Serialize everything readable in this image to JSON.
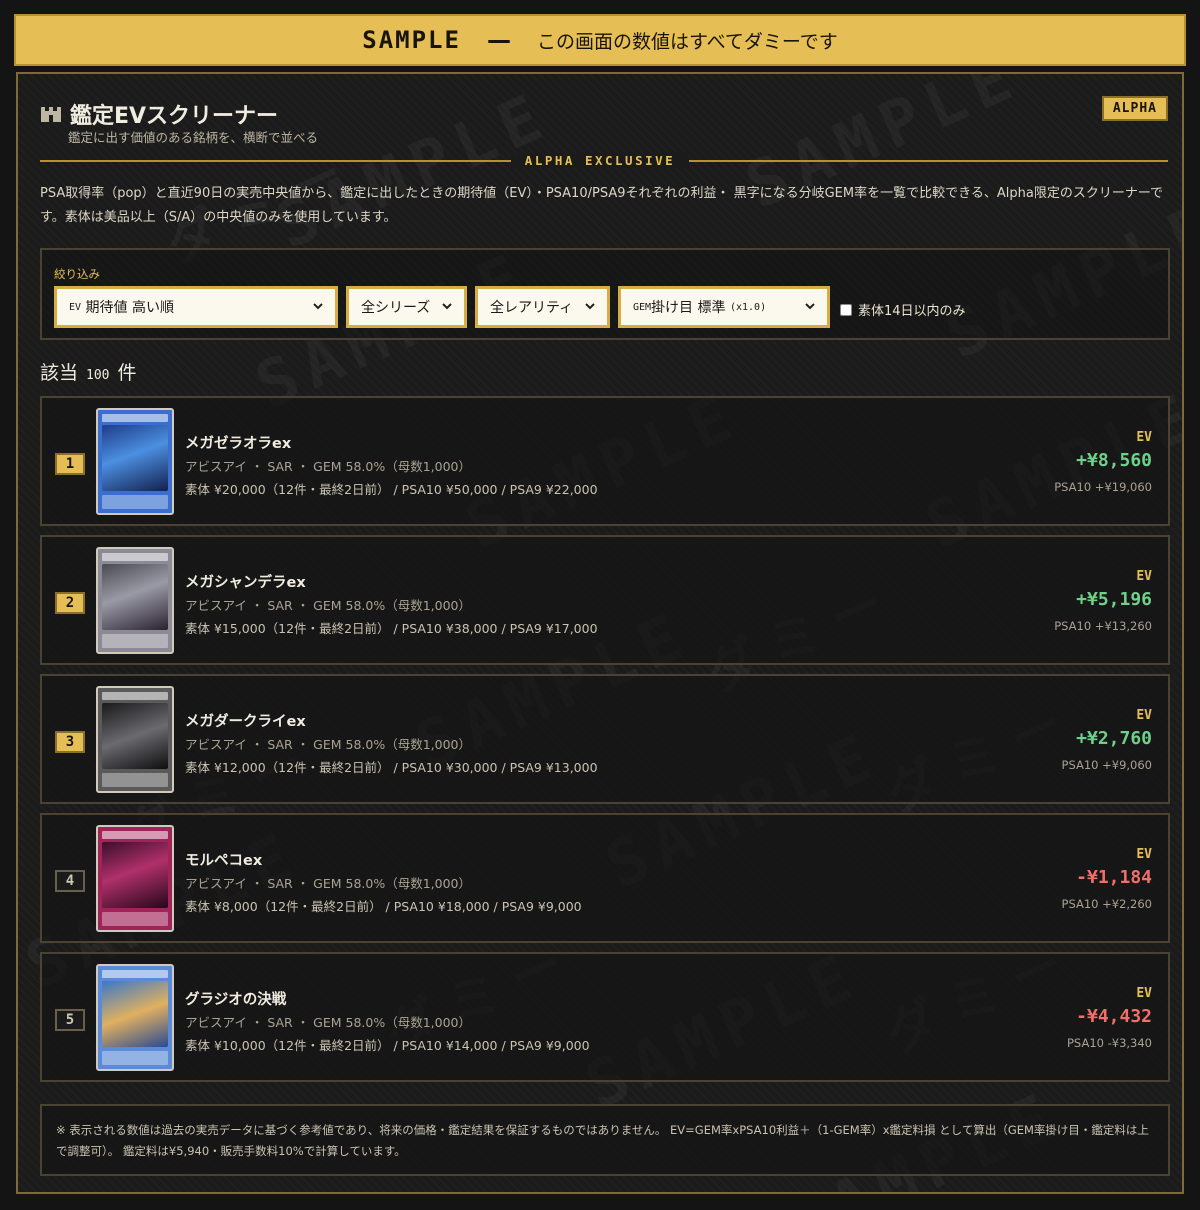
{
  "banner": {
    "sample": "SAMPLE",
    "dash": "—",
    "text": "この画面の数値はすべてダミーです"
  },
  "header": {
    "title": "鑑定EVスクリーナー",
    "subtitle": "鑑定に出す価値のある銘柄を、横断で並べる",
    "badge": "ALPHA",
    "section_label": "ALPHA EXCLUSIVE",
    "description": "PSA取得率（pop）と直近90日の実売中央値から、鑑定に出したときの期待値（EV）・PSA10/PSA9それぞれの利益・ 黒字になる分岐GEM率を一覧で比較できる、Alpha限定のスクリーナーです。素体は美品以上（S/A）の中央値のみを使用しています。"
  },
  "filters": {
    "label": "絞り込み",
    "sort": {
      "prefix": "EV",
      "value": "期待値 高い順"
    },
    "series": "全シリーズ",
    "rarity": "全レアリティ",
    "gem": {
      "prefix": "GEM",
      "value": "掛け目 標準",
      "suffix": "(x1.0)"
    },
    "checkbox_label": "素体14日以内のみ"
  },
  "results": {
    "prefix": "該当",
    "count": "100",
    "suffix": "件"
  },
  "watermark": {
    "latin": "SAMPLE",
    "jp": "ダミー"
  },
  "ev_label": "EV",
  "colors": {
    "accent": "#e5bf55",
    "positive": "#6fd08a",
    "negative": "#ef6f6a"
  },
  "chart_data": {
    "type": "table",
    "columns": [
      "rank",
      "name",
      "meta",
      "prices",
      "ev",
      "psa10_profit"
    ],
    "rows": [
      {
        "rank": "1",
        "name": "メガゼラオラex",
        "meta": "アビスアイ ・ SAR ・ GEM 58.0%（母数1,000）",
        "prices": "素体 ¥20,000（12件・最終2日前） / PSA10 ¥50,000 / PSA9 ¥22,000",
        "ev": "+¥8,560",
        "ev_value": 8560,
        "psa10": "PSA10 +¥19,060"
      },
      {
        "rank": "2",
        "name": "メガシャンデラex",
        "meta": "アビスアイ ・ SAR ・ GEM 58.0%（母数1,000）",
        "prices": "素体 ¥15,000（12件・最終2日前） / PSA10 ¥38,000 / PSA9 ¥17,000",
        "ev": "+¥5,196",
        "ev_value": 5196,
        "psa10": "PSA10 +¥13,260"
      },
      {
        "rank": "3",
        "name": "メガダークライex",
        "meta": "アビスアイ ・ SAR ・ GEM 58.0%（母数1,000）",
        "prices": "素体 ¥12,000（12件・最終2日前） / PSA10 ¥30,000 / PSA9 ¥13,000",
        "ev": "+¥2,760",
        "ev_value": 2760,
        "psa10": "PSA10 +¥9,060"
      },
      {
        "rank": "4",
        "name": "モルペコex",
        "meta": "アビスアイ ・ SAR ・ GEM 58.0%（母数1,000）",
        "prices": "素体 ¥8,000（12件・最終2日前） / PSA10 ¥18,000 / PSA9 ¥9,000",
        "ev": "-¥1,184",
        "ev_value": -1184,
        "psa10": "PSA10 +¥2,260"
      },
      {
        "rank": "5",
        "name": "グラジオの決戦",
        "meta": "アビスアイ ・ SAR ・ GEM 58.0%（母数1,000）",
        "prices": "素体 ¥10,000（12件・最終2日前） / PSA10 ¥14,000 / PSA9 ¥9,000",
        "ev": "-¥4,432",
        "ev_value": -4432,
        "psa10": "PSA10 -¥3,340"
      }
    ]
  },
  "cards": [
    {
      "art": "linear-gradient(160deg,#1d3c8a,#4c8fe0 45%,#122050)",
      "frame": "#3a6fd0"
    },
    {
      "art": "linear-gradient(160deg,#4a4a52,#9a9aa6 45%,#2a2230)",
      "frame": "#8c8a95"
    },
    {
      "art": "linear-gradient(160deg,#1a1a1a,#6a6a70 50%,#0e0e0e)",
      "frame": "#5a5a5a"
    },
    {
      "art": "linear-gradient(160deg,#3a0f2a,#b0306a 45%,#26081a)",
      "frame": "#a0245a"
    },
    {
      "art": "linear-gradient(160deg,#3a78c8,#e0b060 50%,#2a4a90)",
      "frame": "#5a8ad8"
    }
  ],
  "footnote": "※ 表示される数値は過去の実売データに基づく参考値であり、将来の価格・鑑定結果を保証するものではありません。 EV=GEM率xPSA10利益＋（1-GEM率）x鑑定料損 として算出（GEM率掛け目・鑑定料は上で調整可）。 鑑定料は¥5,940・販売手数料10%で計算しています。"
}
